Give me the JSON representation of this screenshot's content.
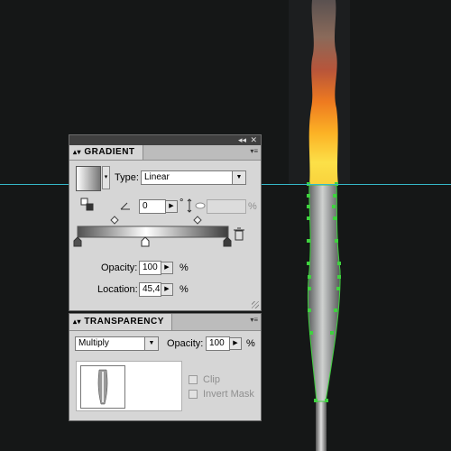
{
  "gradient_panel": {
    "tab_label": "GRADIENT",
    "type_label": "Type:",
    "type_value": "Linear",
    "angle_value": "0",
    "degree_symbol": "°",
    "aspect_unit": "%",
    "opacity_label": "Opacity:",
    "opacity_value": "100",
    "opacity_unit": "%",
    "location_label": "Location:",
    "location_value": "45,4",
    "location_unit": "%"
  },
  "transparency_panel": {
    "tab_label": "TRANSPARENCY",
    "blend_mode": "Multiply",
    "opacity_label": "Opacity:",
    "opacity_value": "100",
    "opacity_unit": "%",
    "clip_label": "Clip",
    "invert_mask_label": "Invert Mask"
  },
  "panel_controls": {
    "collapse_glyph": "◂◂",
    "close_glyph": "✕"
  },
  "colors": {
    "canvas_background": "#151717",
    "guide_line": "#35b7c8",
    "panel_background": "#d6d6d6",
    "selection_anchor": "#3fd23f"
  }
}
